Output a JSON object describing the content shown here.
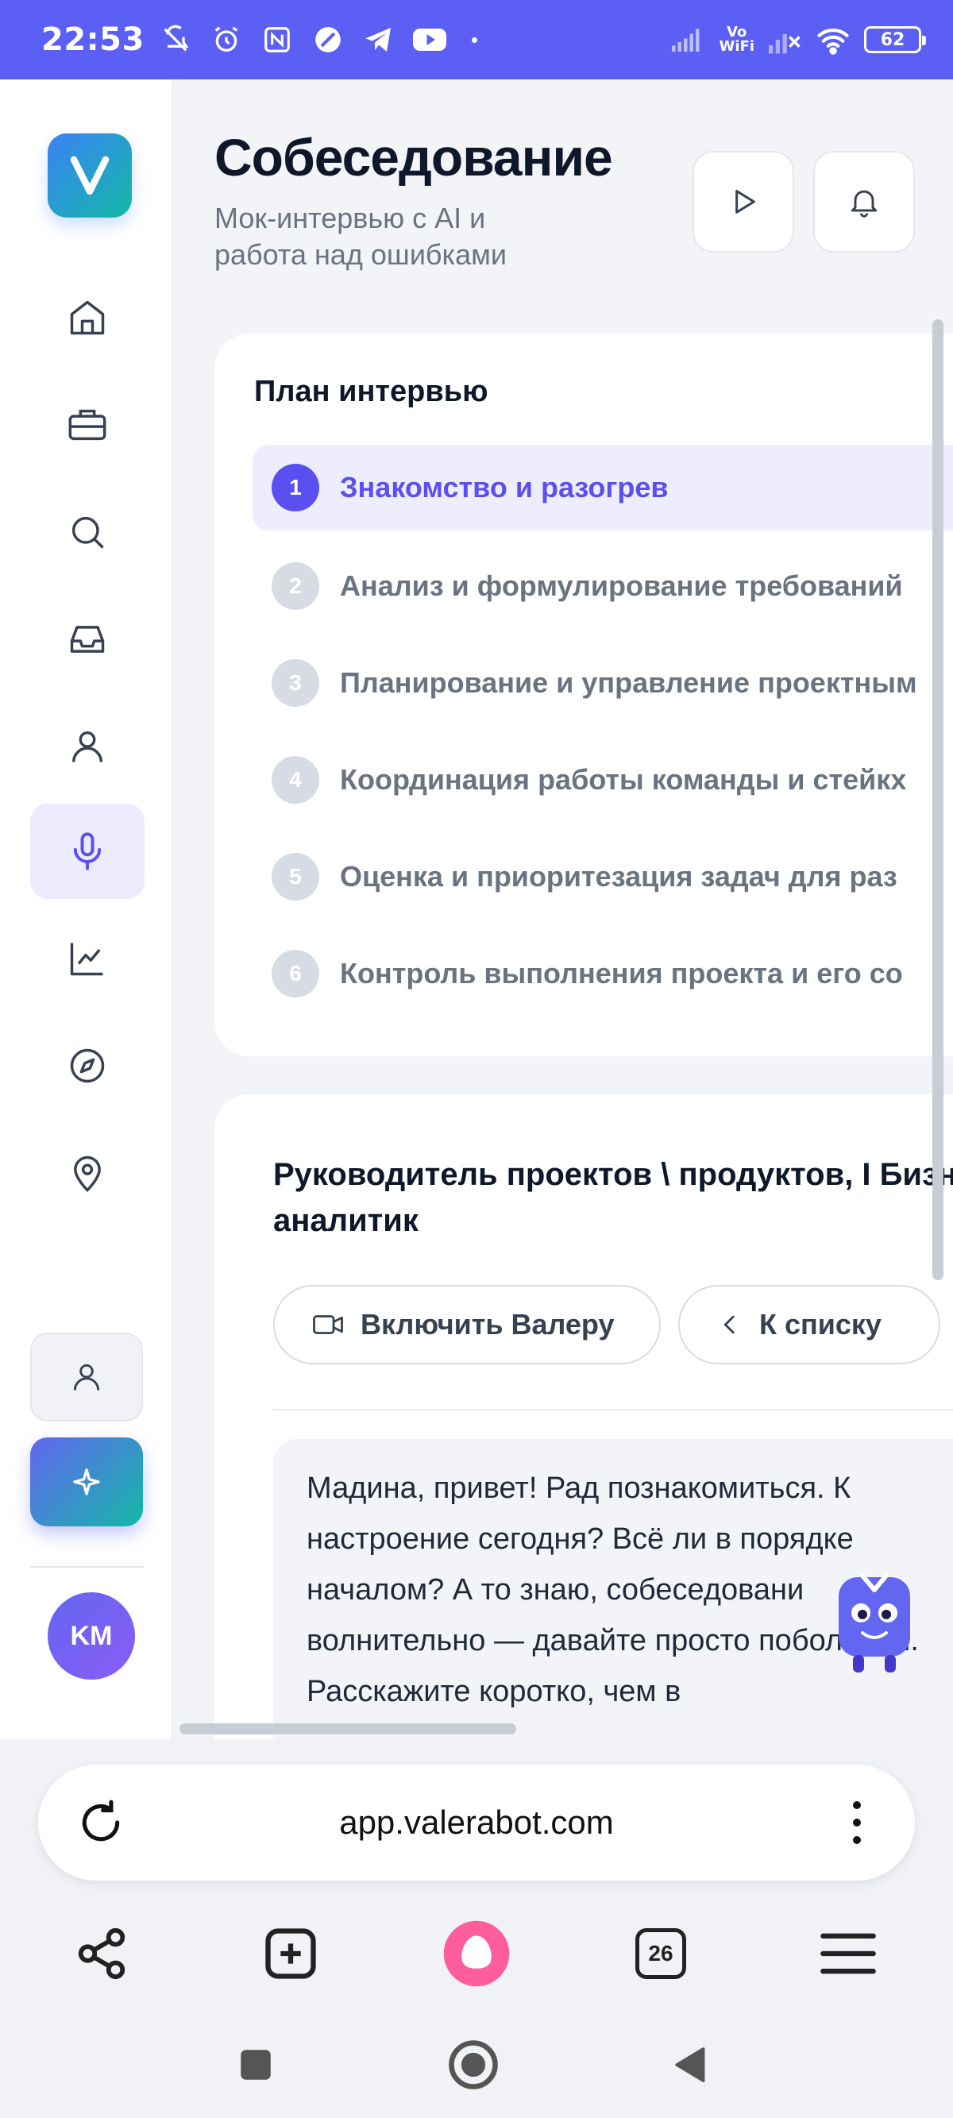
{
  "status_bar": {
    "time": "22:53",
    "network": "Vo WiFi",
    "network_top": "Vo",
    "network_bottom": "WiFi",
    "battery": "62"
  },
  "sidebar": {
    "logo_letter": "V",
    "items": [
      {
        "icon": "home-icon"
      },
      {
        "icon": "briefcase-icon"
      },
      {
        "icon": "search-icon"
      },
      {
        "icon": "inbox-icon"
      },
      {
        "icon": "user-icon"
      },
      {
        "icon": "microphone-icon",
        "active": true
      },
      {
        "icon": "chart-icon"
      },
      {
        "icon": "compass-icon"
      },
      {
        "icon": "map-pin-icon"
      }
    ],
    "avatar_initials": "KM"
  },
  "header": {
    "title": "Собеседование",
    "subtitle": "Мок-интервью с AI и работа над ошибками"
  },
  "plan": {
    "title": "План интервью",
    "steps": [
      {
        "num": "1",
        "label": "Знакомство и разогрев",
        "active": true
      },
      {
        "num": "2",
        "label": "Анализ и формулирование требований"
      },
      {
        "num": "3",
        "label": "Планирование и управление проектным"
      },
      {
        "num": "4",
        "label": "Координация работы команды и стейкх"
      },
      {
        "num": "5",
        "label": "Оценка и приоритезация задач для раз"
      },
      {
        "num": "6",
        "label": "Контроль выполнения проекта и его со"
      }
    ]
  },
  "chat": {
    "title": "Руководитель проектов \\ продуктов, I Бизнес аналитик",
    "enable_label": "Включить Валеру",
    "back_label": "К списку",
    "message": "Мадина, привет! Рад познакомиться. К настроение сегодня? Всё ли в порядке началом? А то знаю, собеседовани волнительно — давайте просто поболтаем. Расскажите коротко, чем в"
  },
  "browser": {
    "url": "app.valerabot.com",
    "tabs_count": "26"
  },
  "colors": {
    "status_bar": "#5b5ff4",
    "accent": "#5b4ff0",
    "active_bg": "#eeedfd"
  }
}
